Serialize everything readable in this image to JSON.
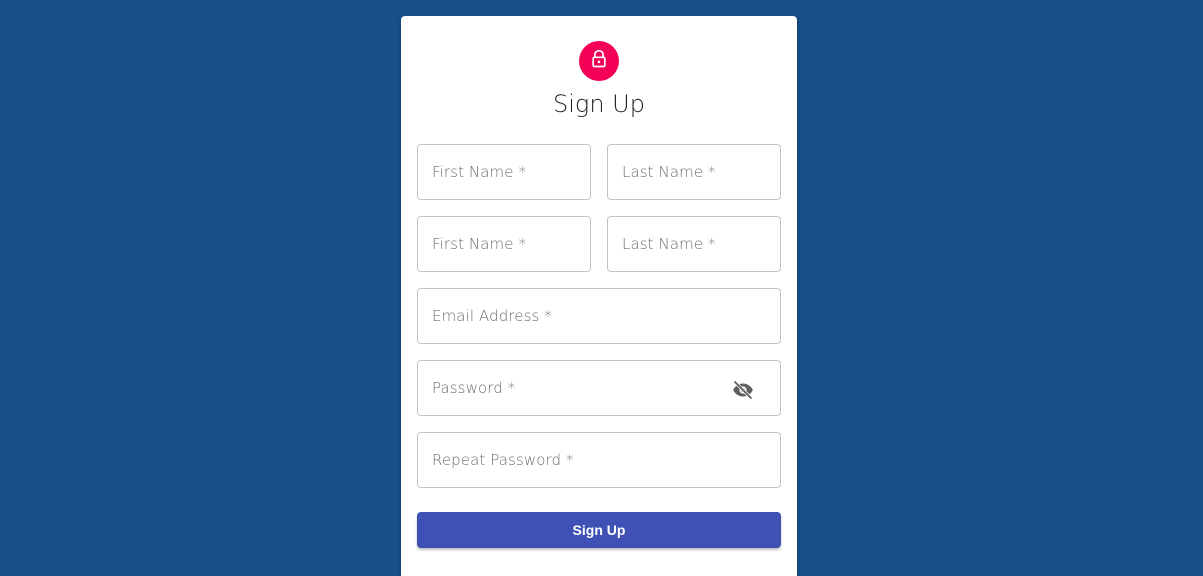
{
  "header": {
    "icon": "lock-icon",
    "icon_color": "#f50057",
    "title": "Sign Up"
  },
  "form": {
    "first_name_1": {
      "label": "First Name *",
      "value": ""
    },
    "last_name_1": {
      "label": "Last Name *",
      "value": ""
    },
    "first_name_2": {
      "label": "First Name *",
      "value": ""
    },
    "last_name_2": {
      "label": "Last Name *",
      "value": ""
    },
    "email": {
      "label": "Email Address *",
      "value": ""
    },
    "password": {
      "label": "Password *",
      "value": "",
      "visibility_icon": "visibility-off-icon"
    },
    "repeat_password": {
      "label": "Repeat Password *",
      "value": ""
    }
  },
  "submit": {
    "label": "Sign Up",
    "color": "#3f51b5"
  },
  "colors": {
    "background": "#174f88",
    "card": "#ffffff"
  }
}
